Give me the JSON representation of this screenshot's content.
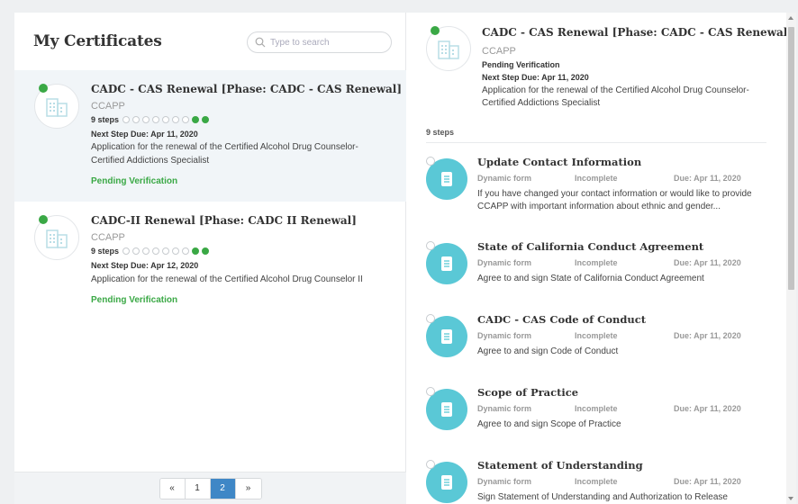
{
  "left": {
    "title": "My Certificates",
    "search_placeholder": "Type to search",
    "certificates": [
      {
        "title": "CADC - CAS Renewal [Phase: CADC - CAS Renewal]",
        "org": "CCAPP",
        "steps_label": "9 steps",
        "steps_total": 9,
        "steps_done": 2,
        "next_step_due": "Next Step Due: Apr 11, 2020",
        "description": "Application for the renewal of the Certified Alcohol Drug Counselor-Certified Addictions Specialist",
        "status": "Pending Verification",
        "selected": true
      },
      {
        "title": "CADC-II Renewal [Phase: CADC II Renewal]",
        "org": "CCAPP",
        "steps_label": "9 steps",
        "steps_total": 9,
        "steps_done": 2,
        "next_step_due": "Next Step Due: Apr 12, 2020",
        "description": "Application for the renewal of the Certified Alcohol Drug Counselor II",
        "status": "Pending Verification",
        "selected": false
      }
    ],
    "pager": {
      "prev": "«",
      "pages": [
        "1",
        "2"
      ],
      "active": "2",
      "next": "»"
    }
  },
  "right": {
    "title": "CADC - CAS Renewal [Phase: CADC - CAS Renewal]",
    "org": "CCAPP",
    "status": "Pending Verification",
    "next_step_due": "Next Step Due: Apr 11, 2020",
    "description": "Application for the renewal of the Certified Alcohol Drug Counselor-Certified Addictions Specialist",
    "steps_label": "9 steps",
    "tasks": [
      {
        "name": "Update Contact Information",
        "type": "Dynamic form",
        "status": "Incomplete",
        "due": "Due: Apr 11, 2020",
        "description": "If you have changed your contact information or would like to provide CCAPP with important information about ethnic and gender..."
      },
      {
        "name": "State of California Conduct Agreement",
        "type": "Dynamic form",
        "status": "Incomplete",
        "due": "Due: Apr 11, 2020",
        "description": "Agree to and sign State of California Conduct Agreement"
      },
      {
        "name": "CADC - CAS Code of Conduct",
        "type": "Dynamic form",
        "status": "Incomplete",
        "due": "Due: Apr 11, 2020",
        "description": "Agree to and sign Code of Conduct"
      },
      {
        "name": "Scope of Practice",
        "type": "Dynamic form",
        "status": "Incomplete",
        "due": "Due: Apr 11, 2020",
        "description": "Agree to and sign Scope of Practice"
      },
      {
        "name": "Statement of Understanding",
        "type": "Dynamic form",
        "status": "Incomplete",
        "due": "Due: Apr 11, 2020",
        "description": "Sign Statement of Understanding and Authorization to Release"
      }
    ]
  },
  "colors": {
    "accent_green": "#3aa845",
    "accent_blue": "#3f87c6",
    "task_icon": "#5ac8d6"
  }
}
